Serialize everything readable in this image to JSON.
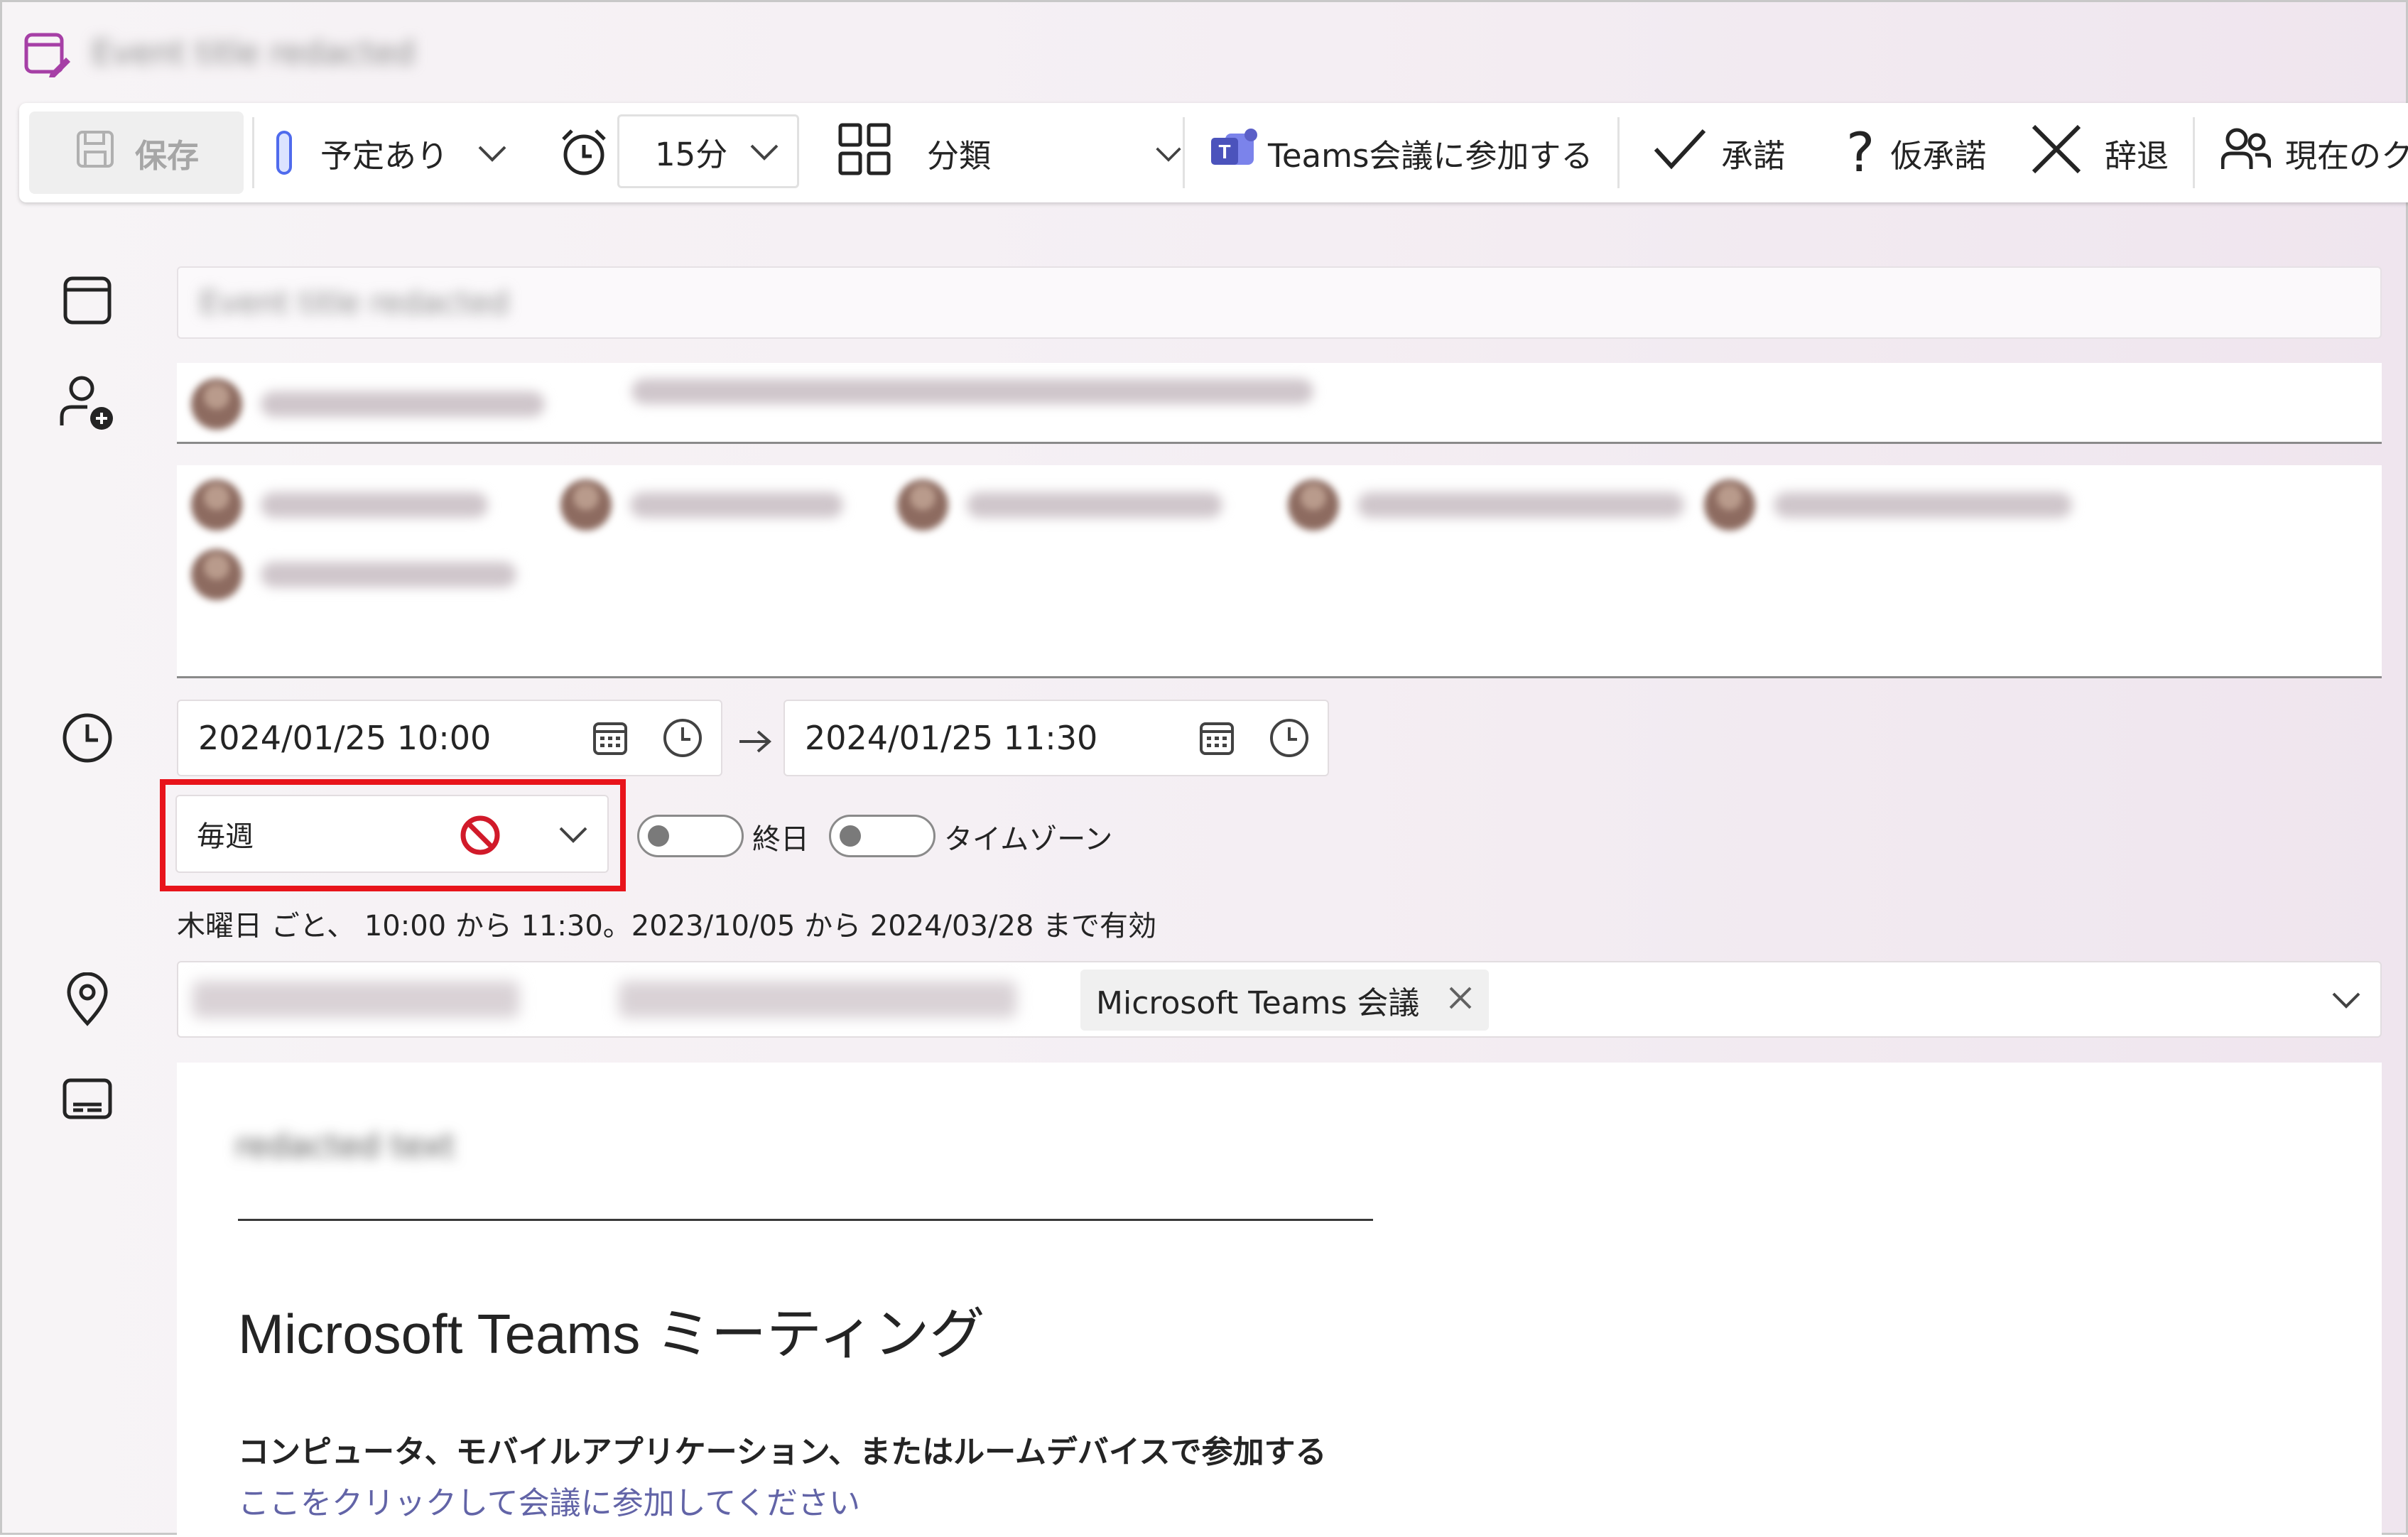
{
  "window": {
    "title": "Event title redacted"
  },
  "toolbar": {
    "save_label": "保存",
    "show_as": "予定あり",
    "reminder": "15分",
    "category_label": "分類",
    "teams_join": "Teams会議に参加する",
    "accept": "承諾",
    "tentative": "仮承諾",
    "decline": "辞退",
    "current": "現在のク"
  },
  "form": {
    "title_value": "Event title redacted",
    "start_datetime": "2024/01/25 10:00",
    "end_datetime": "2024/01/25 11:30",
    "recurrence_value": "毎週",
    "all_day_label": "終日",
    "timezone_label": "タイムゾーン",
    "recurrence_summary": "木曜日 ごと、 10:00 から 11:30。2023/10/05 から 2024/03/28 まで有効",
    "location_chip": "Microsoft Teams 会議"
  },
  "body": {
    "blurred_intro": "redacted text",
    "separator": "________________________________________________________________________________",
    "heading": "Microsoft Teams ミーティング",
    "subheading": "コンピュータ、モバイルアプリケーション、またはルームデバイスで参加する",
    "join_link": "ここをクリックして会議に参加してください"
  },
  "colors": {
    "highlight_red": "#e8141b",
    "no_entry_red": "#d11a2a",
    "accent_purple": "#6264a7",
    "teams_purple": "#5b5fc7"
  }
}
